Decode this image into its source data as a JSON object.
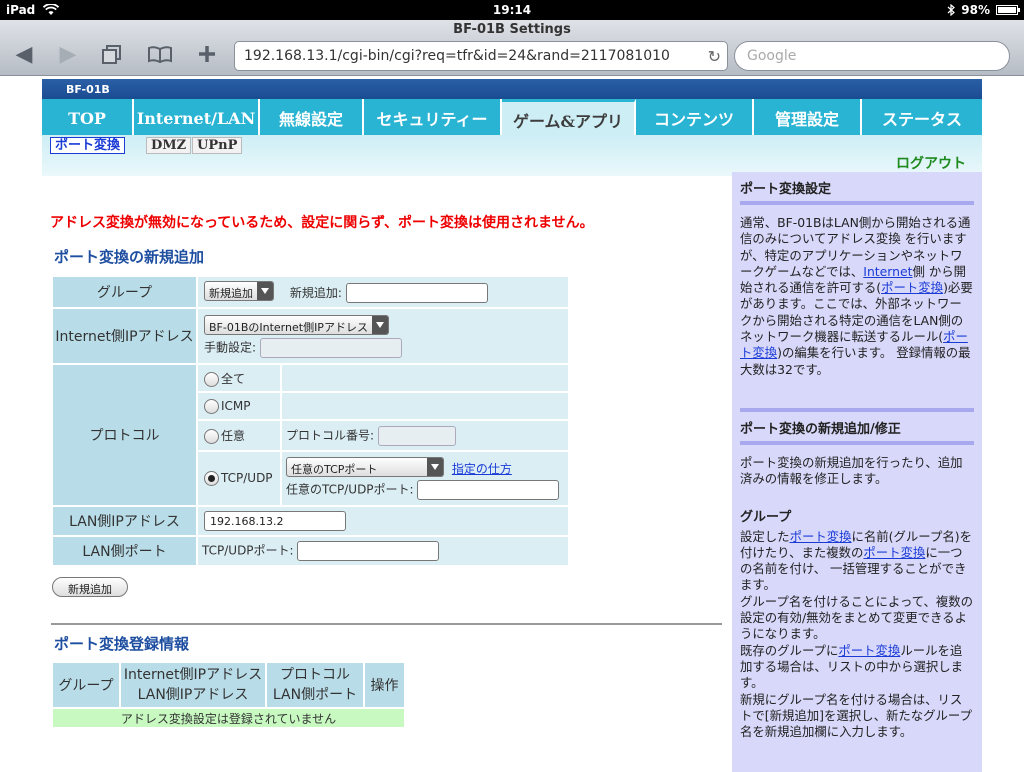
{
  "status_bar": {
    "device": "iPad",
    "time": "19:14",
    "battery": "98%"
  },
  "browser": {
    "window_title": "BF-01B Settings",
    "url": "192.168.13.1/cgi-bin/cgi?req=tfr&id=24&rand=2117081010",
    "search_placeholder": "Google"
  },
  "brand": "BF-01B",
  "nav_tabs": [
    "TOP",
    "Internet/LAN",
    "無線設定",
    "セキュリティー",
    "ゲーム&アプリ",
    "コンテンツ",
    "管理設定",
    "ステータス"
  ],
  "sub_tabs": [
    "ポート変換",
    "DMZ",
    "UPnP"
  ],
  "logout": "ログアウト",
  "warning": "アドレス変換が無効になっているため、設定に関らず、ポート変換は使用されません。",
  "new_entry": {
    "title": "ポート変換の新規追加",
    "group_label": "グループ",
    "group_select": "新規追加",
    "group_new_label": "新規追加:",
    "internet_ip_label": "Internet側IPアドレス",
    "internet_ip_select": "BF-01BのInternet側IPアドレス",
    "manual_label": "手動設定:",
    "protocol_label": "プロトコル",
    "proto_all": "全て",
    "proto_icmp": "ICMP",
    "proto_any": "任意",
    "proto_number_label": "プロトコル番号:",
    "proto_tcpudp": "TCP/UDP",
    "tcp_select": "任意のTCPポート",
    "howto_link": "指定の仕方",
    "any_port_label": "任意のTCP/UDPポート:",
    "lan_ip_label": "LAN側IPアドレス",
    "lan_ip_value": "192.168.13.2",
    "lan_port_label": "LAN側ポート",
    "lan_port_sub": "TCP/UDPポート:",
    "add_button": "新規追加"
  },
  "registered": {
    "title": "ポート変換登録情報",
    "col_group": "グループ",
    "col_ip_1": "Internet側IPアドレス",
    "col_ip_2": "LAN側IPアドレス",
    "col_proto_1": "プロトコル",
    "col_proto_2": "LAN側ポート",
    "col_op": "操作",
    "empty": "アドレス変換設定は登録されていません"
  },
  "help": {
    "h1": "ポート変換設定",
    "p1_a": "通常、BF-01BはLAN側から開始される通信のみについてアドレス変換 を行いますが、特定のアプリケーションやネットワークゲームなどでは、",
    "p1_link1": "Internet",
    "p1_b": "側 から開始される通信を許可する(",
    "p1_link2": "ポート変換",
    "p1_c": ")必要があります。ここでは、外部ネットワークから開始される特定の通信をLAN側のネットワーク機器に転送するルール(",
    "p1_link3": "ポート変換",
    "p1_d": ")の編集を行います。 登録情報の最大数は32です。",
    "h2": "ポート変換の新規追加/修正",
    "p2": "ポート変換の新規追加を行ったり、追加済みの情報を修正します。",
    "h3": "グループ",
    "p3_a": "設定した",
    "p3_link1": "ポート変換",
    "p3_b": "に名前(グループ名)を付けたり、また複数の",
    "p3_link2": "ポート変換",
    "p3_c": "に一つの名前を付け、 一括管理することができます。",
    "p4": "グループ名を付けることによって、複数の設定の有効/無効をまとめて変更できるようになります。",
    "p5_a": "既存のグループに",
    "p5_link": "ポート変換",
    "p5_b": "ルールを追加する場合は、リストの中から選択します。",
    "p6": "新規にグループ名を付ける場合は、リストで[新規追加]を選択し、新たなグループ名を新規追加欄に入力します。"
  }
}
